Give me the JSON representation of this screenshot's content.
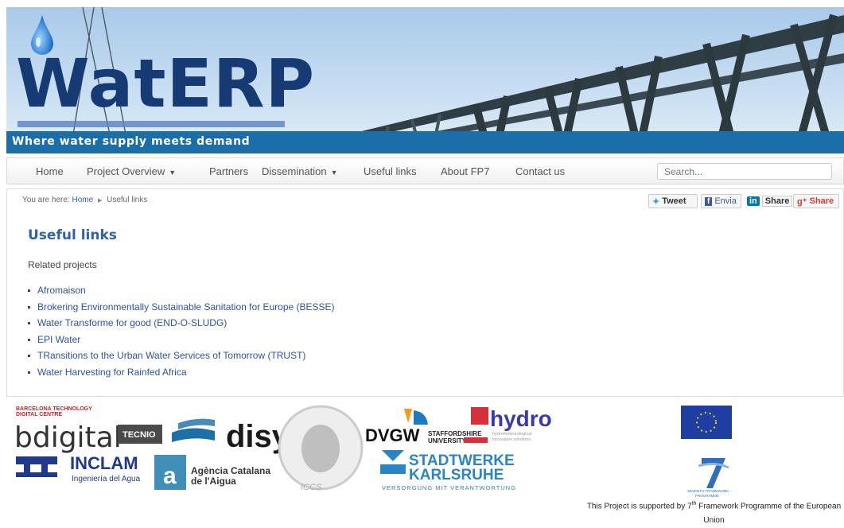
{
  "header": {
    "logo_text": "WatERP",
    "tagline": "Where water supply meets demand"
  },
  "nav": {
    "items": [
      {
        "label": "Home"
      },
      {
        "label": "Project Overview",
        "dropdown": true
      },
      {
        "label": "Partners"
      },
      {
        "label": "Dissemination",
        "dropdown": true
      },
      {
        "label": "Useful links"
      },
      {
        "label": "About FP7"
      },
      {
        "label": "Contact us"
      }
    ],
    "search_placeholder": "Search..."
  },
  "breadcrumb": {
    "prefix": "You are here:",
    "home": "Home",
    "current": "Useful links"
  },
  "share": {
    "tweet": "Tweet",
    "envia": "Envia",
    "linkedin": "Share",
    "gplus": "Share"
  },
  "main": {
    "title": "Useful links",
    "subtitle": "Related projects",
    "links": [
      "Afromaison",
      "Brokering Environmentally Sustainable Sanitation for Europe (BESSE)",
      "Water Transforme for good (END-O-SLUDG)",
      "EPI Water",
      "TRansitions to the Urban Water Services of Tomorrow (TRUST)",
      "Water Harvesting for Rainfed Africa"
    ]
  },
  "footer": {
    "partners": {
      "barcelona": "BARCELONA TECHNOLOGY\nDIGITAL        CENTRE",
      "bdigital": "bdigital",
      "tecnio": "TECNIO",
      "disy": "disy",
      "inclam": "INCLAM",
      "inclam_sub": "Ingeniería del Agua",
      "aca1": "Agència Catalana",
      "aca2": "de l'Aigua",
      "iccs": "ICCS",
      "dvgw": "DVGW",
      "staffordshire1": "STAFFORDSHIRE",
      "staffordshire2": "UNIVERSITY",
      "hydro": "hydro",
      "hydro_sub1": "hydrometeorological",
      "hydro_sub2": "innovative solutions",
      "stadtwerke1": "STADTWERKE",
      "stadtwerke2": "KARLSRUHE",
      "stadtwerke_sub": "VERSORGUNG MIT VERANTWORTUNG",
      "fp7_label1": "SEVENTH FRAMEWORK",
      "fp7_label2": "PROGRAMME"
    },
    "fp7_text_pre": "This Project is supported by 7",
    "fp7_text_sup": "th",
    "fp7_text_post": " Framework Programme of the European Union"
  },
  "colors": {
    "brand_blue": "#153a74",
    "tagline_bar": "#1c6ea8",
    "link_blue": "#2d63ad"
  }
}
